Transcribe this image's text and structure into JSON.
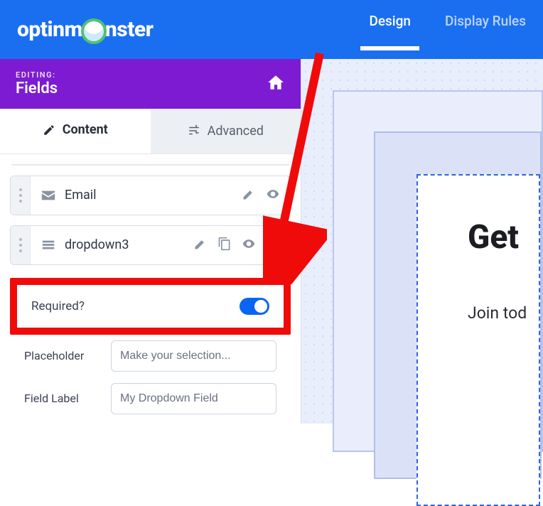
{
  "brand": {
    "left": "optinm",
    "right": "nster"
  },
  "topnav": {
    "design": "Design",
    "rules": "Display Rules"
  },
  "sidebar_header": {
    "editing_label": "EDITING:",
    "editing_value": "Fields"
  },
  "tabs": {
    "content": "Content",
    "advanced": "Advanced"
  },
  "fields": {
    "email": "Email",
    "dropdown": "dropdown3"
  },
  "props": {
    "required_label": "Required?",
    "placeholder_label": "Placeholder",
    "placeholder_value": "Make your selection...",
    "fieldlabel_label": "Field Label",
    "fieldlabel_value": "My Dropdown Field"
  },
  "canvas": {
    "headline": "Get",
    "subline": "Join tod"
  }
}
